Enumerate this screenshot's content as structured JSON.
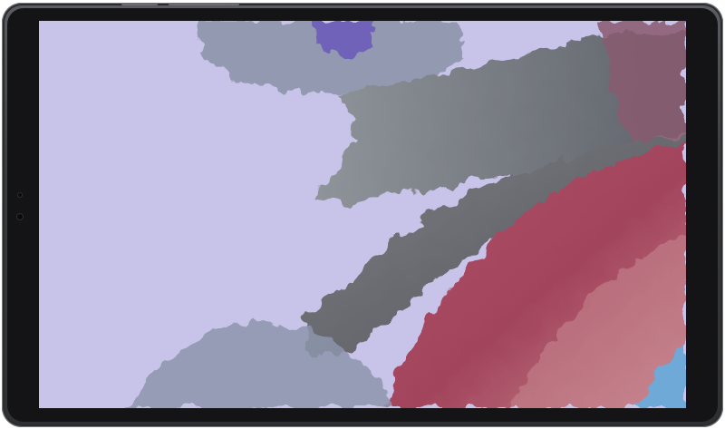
{
  "device": {
    "kind": "tablet",
    "frame_color": "#44454a",
    "bezel_color": "#141416"
  },
  "wallpaper": {
    "base_color": "#c8c3e8",
    "palette": {
      "lavender": "#c8c3e8",
      "violet": "#6f62b8",
      "slate_gray": "#6d6f74",
      "dark_gray": "#4a4b52",
      "blue_gray": "#8d95ab",
      "mauve": "#8a5a70",
      "raspberry": "#a2445c",
      "pink": "#c7878f",
      "sky_blue": "#6ea9d8"
    }
  }
}
